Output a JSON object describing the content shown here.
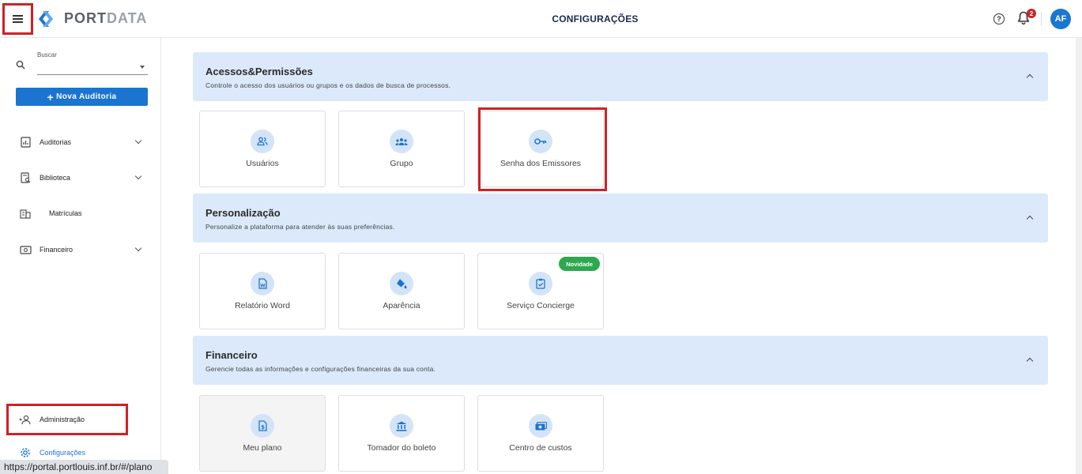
{
  "header": {
    "logo_port": "PORT",
    "logo_data": "DATA",
    "title": "CONFIGURAÇÕES",
    "help_symbol": "?",
    "notification_count": "2",
    "avatar_initials": "AF"
  },
  "sidebar": {
    "search_label": "Buscar",
    "new_button_plus": "+",
    "new_button_label": "Nova Auditoria",
    "items": [
      {
        "label": "Auditorias"
      },
      {
        "label": "Biblioteca"
      },
      {
        "label": "Matrículas"
      },
      {
        "label": "Financeiro"
      },
      {
        "label": "Administração"
      },
      {
        "label": "Configurações"
      }
    ]
  },
  "sections": [
    {
      "title": "Acessos&Permissões",
      "description": "Controle o acesso dos usuários ou grupos e os dados de busca de processos.",
      "cards": [
        {
          "label": "Usuários",
          "icon": "users-icon"
        },
        {
          "label": "Grupo",
          "icon": "group-icon"
        },
        {
          "label": "Senha dos Emissores",
          "icon": "key-icon"
        }
      ]
    },
    {
      "title": "Personalização",
      "description": "Personalize a plataforma para atender às suas preferências.",
      "cards": [
        {
          "label": "Relatório Word",
          "icon": "word-document-icon"
        },
        {
          "label": "Aparência",
          "icon": "paint-bucket-icon"
        },
        {
          "label": "Serviço Concierge",
          "icon": "clipboard-check-icon",
          "badge": "Novidade"
        }
      ]
    },
    {
      "title": "Financeiro",
      "description": "Gerencie todas as informações e configurações financeiras da sua conta.",
      "cards": [
        {
          "label": "Meu plano",
          "icon": "invoice-icon"
        },
        {
          "label": "Tomador do boleto",
          "icon": "bank-icon"
        },
        {
          "label": "Centro de custos",
          "icon": "money-icon"
        }
      ]
    }
  ],
  "status_bar_url": "https://portal.portlouis.inf.br/#/plano",
  "colors": {
    "accent": "#1b74d0",
    "section_bg": "#dce9fb",
    "icon_circle": "#d4e4f8",
    "highlight": "#d21f26",
    "badge_green": "#2ea84f"
  }
}
